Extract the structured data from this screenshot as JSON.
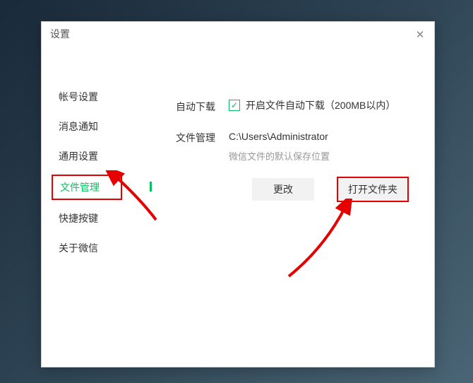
{
  "window": {
    "title": "设置"
  },
  "sidebar": {
    "items": [
      {
        "label": "帐号设置"
      },
      {
        "label": "消息通知"
      },
      {
        "label": "通用设置"
      },
      {
        "label": "文件管理"
      },
      {
        "label": "快捷按键"
      },
      {
        "label": "关于微信"
      }
    ]
  },
  "content": {
    "autodownload": {
      "label": "自动下载",
      "checkbox_text": "开启文件自动下载（200MB以内）",
      "checked": true
    },
    "filemanage": {
      "label": "文件管理",
      "path": "C:\\Users\\Administrator",
      "hint": "微信文件的默认保存位置"
    },
    "buttons": {
      "change": "更改",
      "open_folder": "打开文件夹"
    }
  }
}
